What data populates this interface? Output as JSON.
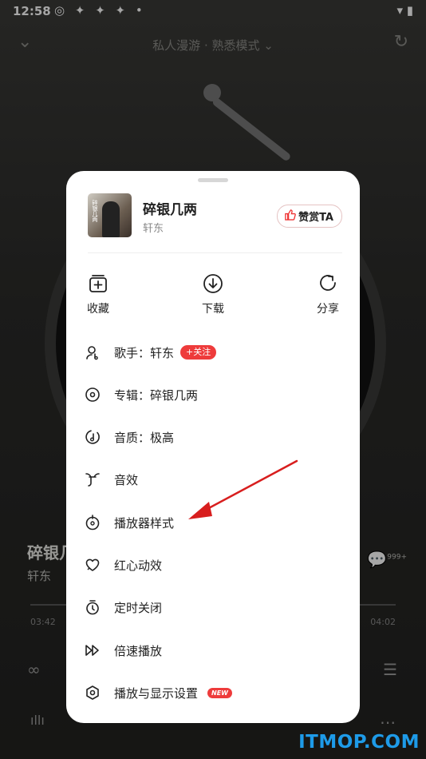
{
  "status_bar": {
    "time": "12:58",
    "icons": "◎ ✦ ✦ ✦ •",
    "right": "▾ ▮"
  },
  "top_bar": {
    "mode": "私人漫游 · 熟悉模式 ⌄"
  },
  "player": {
    "song_title": "碎银几两",
    "artist": "轩东",
    "current_time": "03:42",
    "total_time": "04:02",
    "comment_count": "999+"
  },
  "sheet": {
    "song_title": "碎银几两",
    "artist": "轩东",
    "cover_text": "碎银几两",
    "tip_label": "赞赏TA",
    "actions": [
      {
        "label": "收藏",
        "icon": "add-collection-icon"
      },
      {
        "label": "下载",
        "icon": "download-icon"
      },
      {
        "label": "分享",
        "icon": "share-icon"
      }
    ],
    "menu": [
      {
        "label": "歌手：轩东",
        "icon": "singer-icon",
        "badge": "+关注"
      },
      {
        "label": "专辑：碎银几两",
        "icon": "album-icon"
      },
      {
        "label": "音质：极高",
        "icon": "quality-icon"
      },
      {
        "label": "音效",
        "icon": "sound-effect-icon"
      },
      {
        "label": "播放器样式",
        "icon": "player-style-icon"
      },
      {
        "label": "红心动效",
        "icon": "heart-effect-icon"
      },
      {
        "label": "定时关闭",
        "icon": "timer-icon"
      },
      {
        "label": "倍速播放",
        "icon": "speed-icon"
      },
      {
        "label": "播放与显示设置",
        "icon": "settings-icon",
        "badge": "NEW"
      }
    ]
  },
  "watermark": "ITMOP.COM",
  "colors": {
    "accent": "#ee3b3b",
    "annotation_arrow": "#d81e1e",
    "watermark": "#1e9be8"
  }
}
